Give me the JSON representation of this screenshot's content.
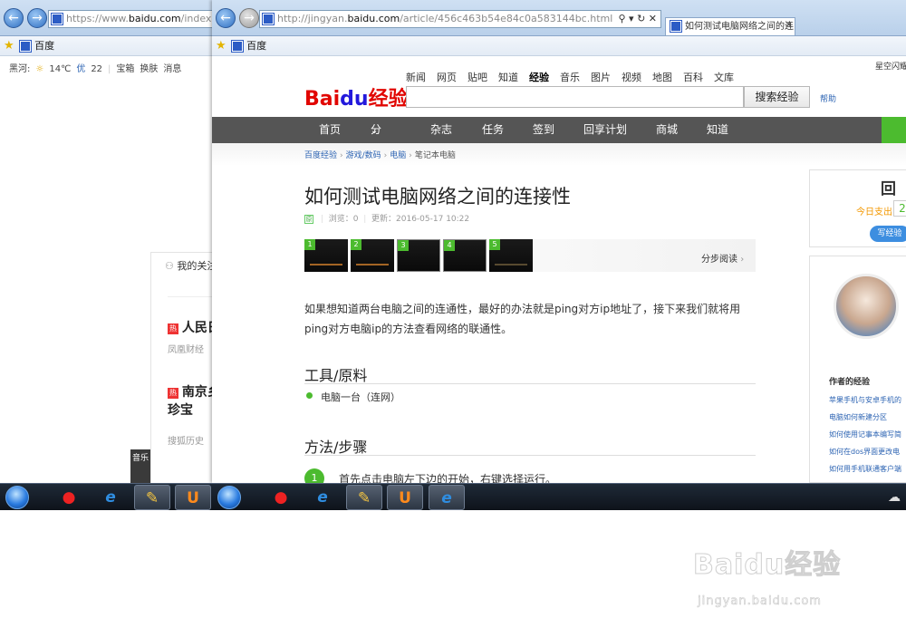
{
  "back_browser": {
    "url_domain": "https://www.",
    "url_bold": "baidu.com",
    "url_rest": "/index.php?tn=",
    "favorite": "百度",
    "weather": {
      "city": "黑河:",
      "temp": "14℃",
      "aqi_label": "优",
      "aqi": "22"
    },
    "links": [
      "宝箱",
      "换肤",
      "消息"
    ],
    "follow_label": "我的关注",
    "hot_badge": "热",
    "news": [
      {
        "title": "人民日",
        "source": "凤凰财经"
      },
      {
        "title": "南京乡",
        "title2": "珍宝",
        "source": "搜狐历史"
      }
    ],
    "music_tab": "音乐"
  },
  "front_browser": {
    "url_domain": "http://jingyan.",
    "url_bold": "baidu.com",
    "url_rest": "/article/456c463b54e84c0a583144bc.html",
    "tab_title": "如何测试电脑网络之间的连...",
    "favorite": "百度"
  },
  "site": {
    "top_right": "星空闪耀",
    "top_nav": [
      "新闻",
      "网页",
      "贴吧",
      "知道",
      "经验",
      "音乐",
      "图片",
      "视频",
      "地图",
      "百科",
      "文库"
    ],
    "current_nav": "经验",
    "logo": {
      "part1": "Bai",
      "part2": "du",
      "part3": "经验"
    },
    "search_button": "搜索经验",
    "help": "帮助",
    "menu": [
      "首页",
      "分类",
      "杂志",
      "任务",
      "签到",
      "回享计划",
      "商城",
      "知道"
    ],
    "menu_arrow": "⌄",
    "breadcrumb": [
      "百度经验",
      "游戏/数码",
      "电脑",
      "笔记本电脑"
    ]
  },
  "article": {
    "title": "如何测试电脑网络之间的连接性",
    "badge": "原",
    "views_label": "浏览：0",
    "updated_label": "更新：2016-05-17 10:22",
    "steps_thumbs": [
      "1",
      "2",
      "3",
      "4",
      "5"
    ],
    "step_read": "分步阅读",
    "intro": "如果想知道两台电脑之间的连通性，最好的办法就是ping对方ip地址了，接下来我们就将用ping对方电脑ip的方法查看网络的联通性。",
    "tools_heading": "工具/原料",
    "tool_item": "电脑一台（连网）",
    "method_heading": "方法/步骤",
    "step1_num": "1",
    "step1_text": "首先点击电脑左下边的开始，右键选择运行。"
  },
  "sidebar": {
    "promo_title": "回",
    "promo_sub": "今日支出",
    "promo_num": "2",
    "write_button": "写经验",
    "author_heading": "作者的经验",
    "author_links": [
      "苹果手机与安卓手机的",
      "电脑如何新建分区",
      "如何使用记事本编写简",
      "如何在dos界面更改电",
      "如何用手机联通客户端"
    ]
  },
  "watermark": {
    "logo": "Baidu经验",
    "url": "jingyan.baidu.com"
  },
  "icons": {
    "back": "back-arrow-icon",
    "forward": "forward-arrow-icon",
    "search": "search-icon",
    "refresh": "refresh-icon",
    "close": "close-icon",
    "star": "favorites-star-icon"
  }
}
